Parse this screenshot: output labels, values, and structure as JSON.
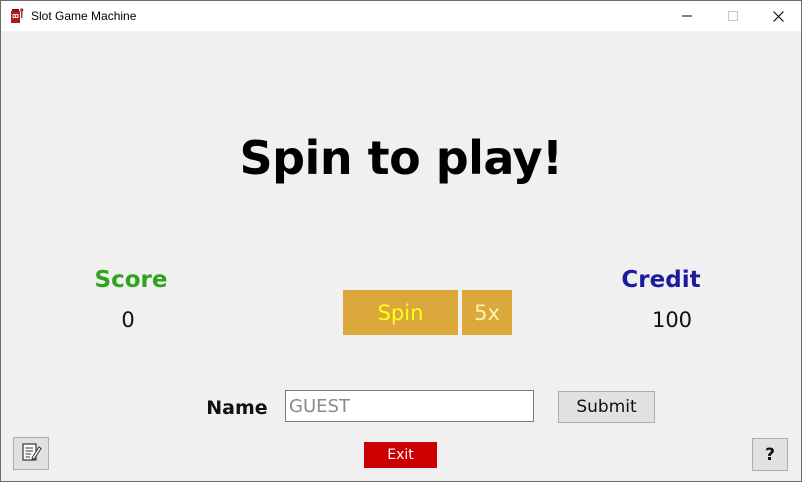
{
  "window": {
    "title": "Slot Game Machine",
    "app_icon": "slot-machine-icon",
    "minimize_icon": "minimize-icon",
    "maximize_icon": "maximize-icon",
    "close_icon": "close-icon"
  },
  "main": {
    "headline": "Spin to play!"
  },
  "score": {
    "label": "Score",
    "value": "0",
    "color": "#2ea31b"
  },
  "credit": {
    "label": "Credit",
    "value": "100",
    "color": "#1b1ba0"
  },
  "controls": {
    "spin_label": "Spin",
    "multiplier_label": "5x",
    "button_color": "#daa83b"
  },
  "name_form": {
    "label": "Name",
    "placeholder": "GUEST",
    "value": "",
    "submit_label": "Submit"
  },
  "footer": {
    "notes_icon": "notes-icon",
    "exit_label": "Exit",
    "exit_color": "#cc0000",
    "help_label": "?"
  }
}
